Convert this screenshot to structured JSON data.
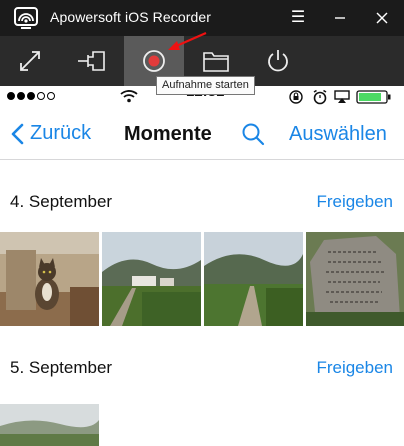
{
  "window": {
    "title": "Apowersoft iOS Recorder",
    "menu_glyph": "☰"
  },
  "toolbar": {
    "tools": [
      {
        "name": "fullscreen"
      },
      {
        "name": "pin"
      },
      {
        "name": "record",
        "active": true
      },
      {
        "name": "folder"
      },
      {
        "name": "power"
      }
    ],
    "tooltip": "Aufnahme starten",
    "accent": "#e23b3b"
  },
  "phone": {
    "status": {
      "time": "12:31",
      "signal_dots_filled": 3,
      "signal_dots_total": 5
    },
    "nav": {
      "back_label": "Zurück",
      "title": "Momente",
      "select_label": "Auswählen"
    },
    "sections": [
      {
        "date": "4. September",
        "action": "Freigeben",
        "photos": [
          "cat-photo",
          "village-field-photo",
          "country-road-photo",
          "stone-inscription-photo"
        ]
      },
      {
        "date": "5. September",
        "action": "Freigeben",
        "photos": [
          "misty-field-photo"
        ]
      }
    ],
    "colors": {
      "link": "#1a86e6",
      "battery": "#4cd964"
    }
  }
}
